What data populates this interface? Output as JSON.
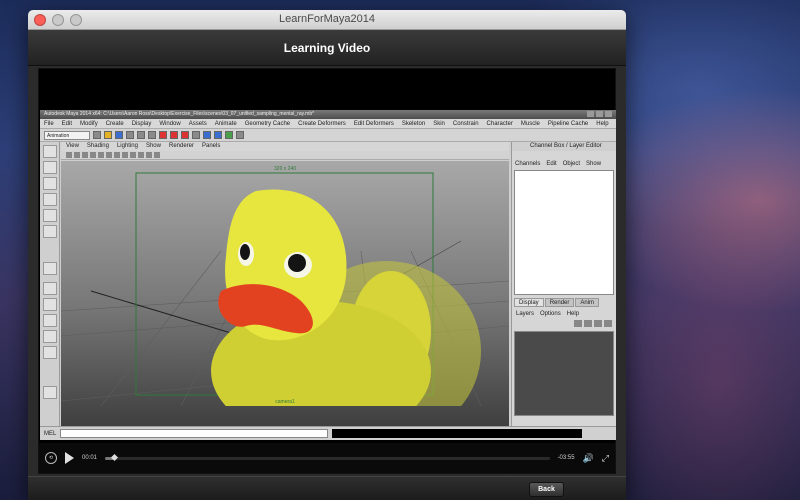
{
  "window": {
    "title": "LearnForMaya2014"
  },
  "header": {
    "title": "Learning Video"
  },
  "maya": {
    "title": "Autodesk Maya 2014 x64: C:\\Users\\Aaron Ross\\Desktop\\Exercise_Files\\scenes\\03_07_unified_sampling_mental_ray.mb*",
    "menu": [
      "File",
      "Edit",
      "Modify",
      "Create",
      "Display",
      "Window",
      "Assets",
      "Animate",
      "Geometry Cache",
      "Create Deformers",
      "Edit Deformers",
      "Skeleton",
      "Skin",
      "Constrain",
      "Character",
      "Muscle",
      "Pipeline Cache",
      "Help"
    ],
    "mode": "Animation",
    "panel_menu": [
      "View",
      "Shading",
      "Lighting",
      "Show",
      "Renderer",
      "Panels"
    ],
    "resolution": "320 x 240",
    "camera_label": "camera1",
    "channel_box": {
      "title": "Channel Box / Layer Editor",
      "menu": [
        "Channels",
        "Edit",
        "Object",
        "Show"
      ],
      "tabs": [
        "Display",
        "Render",
        "Anim"
      ],
      "layer_menu": [
        "Layers",
        "Options",
        "Help"
      ]
    },
    "cmd_label": "MEL"
  },
  "controls": {
    "elapsed": "00:01",
    "remaining": "-03:55",
    "progress": 0.02
  },
  "footer": {
    "back_label": "Back"
  }
}
